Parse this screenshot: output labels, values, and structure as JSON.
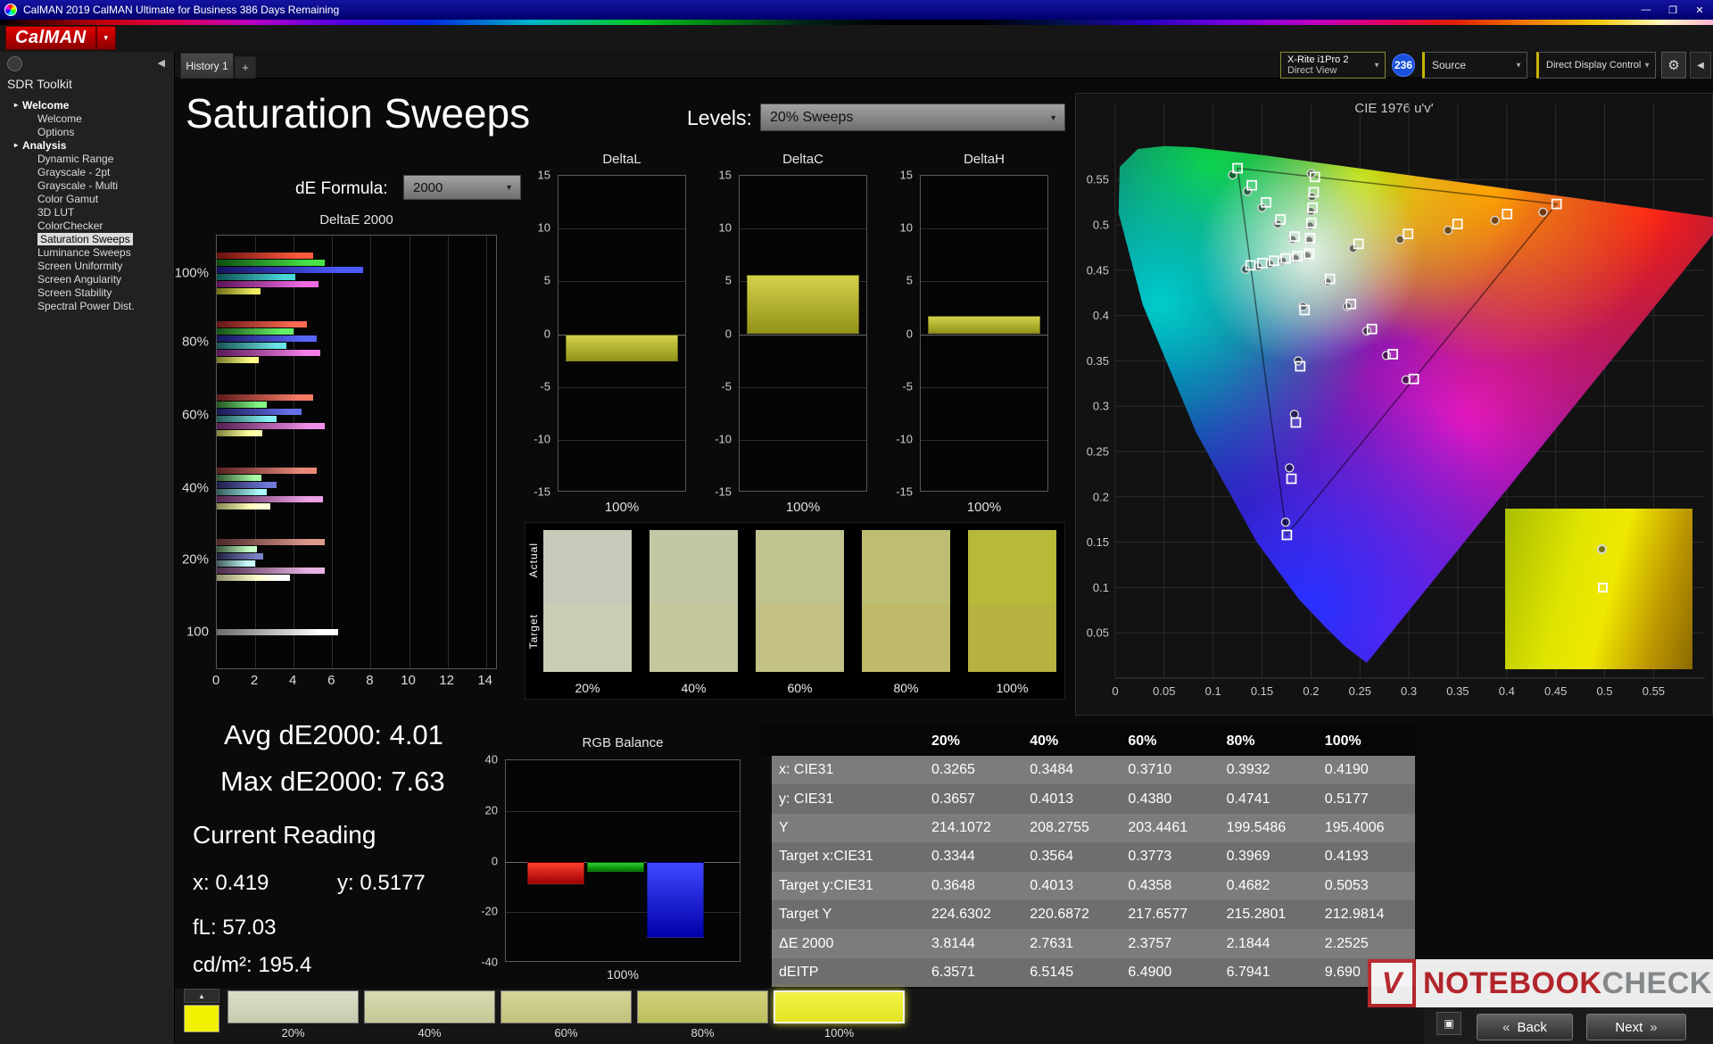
{
  "window": {
    "title": "CalMAN 2019 CalMAN Ultimate for Business 386 Days Remaining"
  },
  "icons": {
    "caret": "▼",
    "up_arrow": "▲",
    "window": "▣",
    "collapse_left": "◀",
    "gear": "⚙",
    "min": "—",
    "max": "❐",
    "close": "✕",
    "tree_arrow": "▸"
  },
  "logo": {
    "text": "CalMAN",
    "color": "#c40000"
  },
  "toolbar": {
    "meter_line1": "X-Rite i1Pro 2",
    "meter_line2": "Direct View",
    "badge": "236",
    "source": "Source",
    "display_control": "Direct Display Control"
  },
  "tabs": {
    "history": "History 1",
    "add": "+"
  },
  "sidebar": {
    "header": "SDR Toolkit",
    "items": [
      {
        "label": "Welcome",
        "level": 0,
        "bold": true
      },
      {
        "label": "Welcome",
        "level": 1
      },
      {
        "label": "Options",
        "level": 1
      },
      {
        "label": "Analysis",
        "level": 0,
        "bold": true
      },
      {
        "label": "Dynamic Range",
        "level": 1
      },
      {
        "label": "Grayscale - 2pt",
        "level": 1
      },
      {
        "label": "Grayscale - Multi",
        "level": 1
      },
      {
        "label": "Color Gamut",
        "level": 1
      },
      {
        "label": "3D LUT",
        "level": 1
      },
      {
        "label": "ColorChecker",
        "level": 1
      },
      {
        "label": "Saturation Sweeps",
        "level": 1,
        "selected": true
      },
      {
        "label": "Luminance Sweeps",
        "level": 1
      },
      {
        "label": "Screen Uniformity",
        "level": 1
      },
      {
        "label": "Screen Angularity",
        "level": 1
      },
      {
        "label": "Screen Stability",
        "level": 1
      },
      {
        "label": "Spectral Power Dist.",
        "level": 1
      }
    ]
  },
  "page": {
    "title": "Saturation Sweeps",
    "levels_label": "Levels:",
    "levels_value": "20% Sweeps",
    "formula_label": "dE Formula:",
    "formula_value": "2000"
  },
  "deltae_chart": {
    "title": "DeltaE 2000",
    "x_ticks": [
      0,
      2,
      4,
      6,
      8,
      10,
      12,
      14
    ],
    "bar_colors": {
      "red": [
        "#6a1010",
        "#ff5a3c"
      ],
      "green": [
        "#0d4d0d",
        "#46e246"
      ],
      "blue": [
        "#14145e",
        "#4b5aff"
      ],
      "cyan": [
        "#0c4f4f",
        "#48d6d6"
      ],
      "magenta": [
        "#5c1258",
        "#ee6ae2"
      ],
      "yellow": [
        "#6e6e16",
        "#eeee64"
      ],
      "white": [
        "#6a6a6a",
        "#ffffff"
      ]
    },
    "groups": [
      {
        "label": "100%",
        "sat": 1,
        "bars": [
          [
            "red",
            5.0
          ],
          [
            "green",
            5.6
          ],
          [
            "blue",
            7.63
          ],
          [
            "cyan",
            4.1
          ],
          [
            "magenta",
            5.3
          ],
          [
            "yellow",
            2.25
          ]
        ]
      },
      {
        "label": "80%",
        "sat": 0.8,
        "bars": [
          [
            "red",
            4.7
          ],
          [
            "green",
            4.0
          ],
          [
            "blue",
            5.2
          ],
          [
            "cyan",
            3.6
          ],
          [
            "magenta",
            5.4
          ],
          [
            "yellow",
            2.18
          ]
        ]
      },
      {
        "label": "60%",
        "sat": 0.62,
        "bars": [
          [
            "red",
            5.0
          ],
          [
            "green",
            2.6
          ],
          [
            "blue",
            4.4
          ],
          [
            "cyan",
            3.1
          ],
          [
            "magenta",
            5.6
          ],
          [
            "yellow",
            2.38
          ]
        ]
      },
      {
        "label": "40%",
        "sat": 0.45,
        "bars": [
          [
            "red",
            5.2
          ],
          [
            "green",
            2.3
          ],
          [
            "blue",
            3.1
          ],
          [
            "cyan",
            2.6
          ],
          [
            "magenta",
            5.5
          ],
          [
            "yellow",
            2.76
          ]
        ]
      },
      {
        "label": "20%",
        "sat": 0.3,
        "bars": [
          [
            "red",
            5.6
          ],
          [
            "green",
            2.1
          ],
          [
            "blue",
            2.4
          ],
          [
            "cyan",
            2.0
          ],
          [
            "magenta",
            5.6
          ],
          [
            "yellow",
            3.81
          ]
        ]
      },
      {
        "label": "100",
        "sat": 1,
        "bars": [
          [
            "white",
            6.3
          ]
        ]
      }
    ]
  },
  "delta_charts": {
    "y_ticks": [
      15,
      10,
      5,
      0,
      -5,
      -10,
      -15
    ],
    "range": 15,
    "x_label": "100%",
    "bar_color": [
      "#d2d24a",
      "#93931a"
    ],
    "charts": [
      {
        "title": "DeltaL",
        "value": -2.6
      },
      {
        "title": "DeltaC",
        "value": 5.6
      },
      {
        "title": "DeltaH",
        "value": 1.7
      }
    ]
  },
  "swatches": {
    "actual_label": "Actual",
    "target_label": "Target",
    "items": [
      {
        "label": "20%",
        "actual": "#c6cab9",
        "target": "#cbceb5"
      },
      {
        "label": "40%",
        "actual": "#c4c7a4",
        "target": "#c7c79d"
      },
      {
        "label": "60%",
        "actual": "#c1c38f",
        "target": "#c3c185"
      },
      {
        "label": "80%",
        "actual": "#bdbe72",
        "target": "#beba69"
      },
      {
        "label": "100%",
        "actual": "#b9b938",
        "target": "#b6b240"
      }
    ]
  },
  "cie": {
    "title": "CIE 1976 u'v'",
    "x_ticks": [
      "0",
      "0.05",
      "0.1",
      "0.15",
      "0.2",
      "0.25",
      "0.3",
      "0.35",
      "0.4",
      "0.45",
      "0.5",
      "0.55"
    ],
    "y_ticks": [
      "0.05",
      "0.1",
      "0.15",
      "0.2",
      "0.25",
      "0.3",
      "0.35",
      "0.4",
      "0.45",
      "0.5",
      "0.55"
    ],
    "locus": [
      [
        0.257,
        0.017
      ],
      [
        0.2347,
        0.035
      ],
      [
        0.2161,
        0.0549
      ],
      [
        0.1877,
        0.0871
      ],
      [
        0.1441,
        0.151
      ],
      [
        0.0828,
        0.2708
      ],
      [
        0.0282,
        0.4117
      ],
      [
        0.0035,
        0.5131
      ],
      [
        0.0046,
        0.5639
      ],
      [
        0.0231,
        0.5837
      ],
      [
        0.0501,
        0.5868
      ],
      [
        0.0792,
        0.5856
      ],
      [
        0.1531,
        0.5766
      ],
      [
        0.2623,
        0.5604
      ],
      [
        0.4035,
        0.5394
      ],
      [
        0.5203,
        0.5219
      ],
      [
        0.6234,
        0.5065
      ]
    ],
    "gamut_triangle": [
      [
        0.451,
        0.523
      ],
      [
        0.125,
        0.5625
      ],
      [
        0.175,
        0.158
      ]
    ],
    "targets": [
      [
        0.198,
        0.468
      ],
      [
        0.2486,
        0.479
      ],
      [
        0.2992,
        0.49
      ],
      [
        0.3498,
        0.501
      ],
      [
        0.4004,
        0.512
      ],
      [
        0.451,
        0.523
      ],
      [
        0.1834,
        0.4871
      ],
      [
        0.1688,
        0.5059
      ],
      [
        0.1542,
        0.5248
      ],
      [
        0.1396,
        0.5436
      ],
      [
        0.125,
        0.5625
      ],
      [
        0.1935,
        0.406
      ],
      [
        0.189,
        0.344
      ],
      [
        0.1845,
        0.282
      ],
      [
        0.18,
        0.22
      ],
      [
        0.1754,
        0.158
      ],
      [
        0.1861,
        0.4655
      ],
      [
        0.1741,
        0.463
      ],
      [
        0.1622,
        0.4604
      ],
      [
        0.1502,
        0.4579
      ],
      [
        0.1383,
        0.4554
      ],
      [
        0.2194,
        0.4404
      ],
      [
        0.2408,
        0.4127
      ],
      [
        0.2623,
        0.3851
      ],
      [
        0.2836,
        0.3574
      ],
      [
        0.305,
        0.33
      ],
      [
        0.1992,
        0.4852
      ],
      [
        0.2004,
        0.5021
      ],
      [
        0.2016,
        0.519
      ],
      [
        0.2028,
        0.536
      ],
      [
        0.2039,
        0.5529
      ]
    ],
    "measurements": [
      [
        0.196,
        0.466
      ],
      [
        0.243,
        0.474
      ],
      [
        0.291,
        0.484
      ],
      [
        0.34,
        0.494
      ],
      [
        0.388,
        0.505
      ],
      [
        0.437,
        0.514
      ],
      [
        0.181,
        0.484
      ],
      [
        0.166,
        0.501
      ],
      [
        0.15,
        0.519
      ],
      [
        0.135,
        0.537
      ],
      [
        0.12,
        0.555
      ],
      [
        0.192,
        0.41
      ],
      [
        0.187,
        0.35
      ],
      [
        0.183,
        0.291
      ],
      [
        0.178,
        0.232
      ],
      [
        0.174,
        0.172
      ],
      [
        0.184,
        0.463
      ],
      [
        0.171,
        0.46
      ],
      [
        0.158,
        0.457
      ],
      [
        0.146,
        0.454
      ],
      [
        0.133,
        0.451
      ],
      [
        0.217,
        0.437
      ],
      [
        0.237,
        0.41
      ],
      [
        0.257,
        0.383
      ],
      [
        0.277,
        0.356
      ],
      [
        0.297,
        0.329
      ],
      [
        0.198,
        0.483
      ],
      [
        0.199,
        0.499
      ],
      [
        0.2,
        0.515
      ],
      [
        0.201,
        0.531
      ],
      [
        0.2002,
        0.5565
      ]
    ]
  },
  "stats": {
    "avg": "Avg dE2000: 4.01",
    "max": "Max dE2000: 7.63",
    "current_label": "Current Reading",
    "x": "x: 0.419",
    "y": "y: 0.5177",
    "fl": "fL: 57.03",
    "cd": "cd/m²: 195.4"
  },
  "rgb_balance": {
    "title": "RGB Balance",
    "y_ticks": [
      40,
      20,
      0,
      -20,
      -40
    ],
    "range": 40,
    "x_label": "100%",
    "bars": [
      {
        "name": "red",
        "color": [
          "#ff4030",
          "#a00000"
        ],
        "value": -9
      },
      {
        "name": "green",
        "color": [
          "#30d030",
          "#007800"
        ],
        "value": -4
      },
      {
        "name": "blue",
        "color": [
          "#4048ff",
          "#0000a8"
        ],
        "value": -30
      }
    ]
  },
  "table": {
    "columns": [
      "20%",
      "40%",
      "60%",
      "80%",
      "100%"
    ],
    "rows": [
      {
        "label": "x: CIE31",
        "values": [
          "0.3265",
          "0.3484",
          "0.3710",
          "0.3932",
          "0.4190"
        ]
      },
      {
        "label": "y: CIE31",
        "values": [
          "0.3657",
          "0.4013",
          "0.4380",
          "0.4741",
          "0.5177"
        ]
      },
      {
        "label": "Y",
        "values": [
          "214.1072",
          "208.2755",
          "203.4461",
          "199.5486",
          "195.4006"
        ]
      },
      {
        "label": "Target x:CIE31",
        "values": [
          "0.3344",
          "0.3564",
          "0.3773",
          "0.3969",
          "0.4193"
        ]
      },
      {
        "label": "Target y:CIE31",
        "values": [
          "0.3648",
          "0.4013",
          "0.4358",
          "0.4682",
          "0.5053"
        ]
      },
      {
        "label": "Target Y",
        "values": [
          "224.6302",
          "220.6872",
          "217.6577",
          "215.2801",
          "212.9814"
        ]
      },
      {
        "label": "ΔE 2000",
        "values": [
          "3.8144",
          "2.7631",
          "2.3757",
          "2.1844",
          "2.2525"
        ]
      },
      {
        "label": "dEITP",
        "values": [
          "6.3571",
          "6.5145",
          "6.4900",
          "6.7941",
          "9.690"
        ]
      }
    ]
  },
  "bottom": {
    "patches": [
      {
        "label": "20%",
        "colors": [
          "#dcdec9",
          "#c8cbae"
        ]
      },
      {
        "label": "40%",
        "colors": [
          "#d8dab2",
          "#c5c795"
        ]
      },
      {
        "label": "60%",
        "colors": [
          "#d4d599",
          "#c1c279"
        ]
      },
      {
        "label": "80%",
        "colors": [
          "#d0d17c",
          "#bdbf5c"
        ]
      },
      {
        "label": "100%",
        "colors": [
          "#f2f246",
          "#e4e424"
        ],
        "selected": true
      }
    ],
    "current_patch_color": "#f2f200",
    "back": "Back",
    "next": "Next",
    "back_icon": "«",
    "next_icon": "»"
  },
  "watermark": {
    "logo": "V",
    "part1": "NOTEBOOK",
    "part2": "CHECK"
  }
}
